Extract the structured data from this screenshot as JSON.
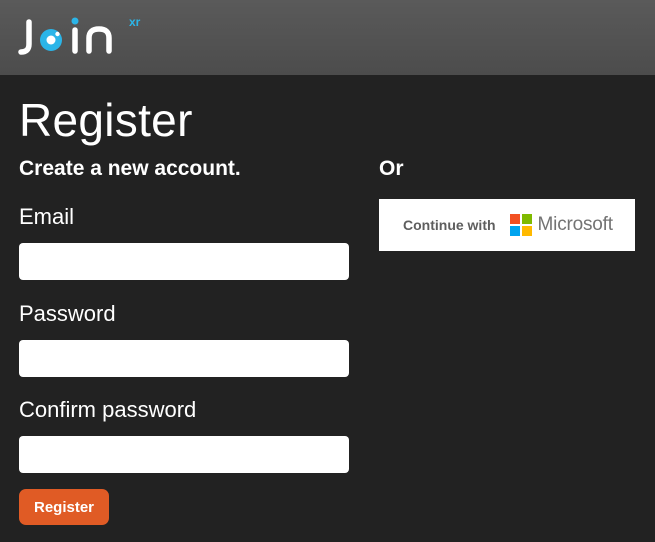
{
  "header": {
    "logo_text": "join",
    "logo_superscript": "xr",
    "logo_accent_color": "#2bb5e8"
  },
  "page": {
    "title": "Register",
    "subtitle": "Create a new account.",
    "or_label": "Or"
  },
  "form": {
    "email_label": "Email",
    "email_value": "",
    "password_label": "Password",
    "password_value": "",
    "confirm_label": "Confirm password",
    "confirm_value": "",
    "register_button": "Register",
    "register_color": "#e05b25"
  },
  "external_login": {
    "continue_label": "Continue with",
    "provider_name": "Microsoft",
    "provider_icon": "microsoft-logo-icon",
    "logo_colors": [
      "#f25022",
      "#7fba00",
      "#00a4ef",
      "#ffb900"
    ]
  }
}
